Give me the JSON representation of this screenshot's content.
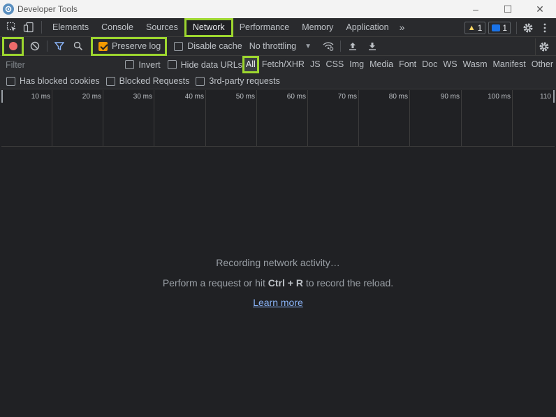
{
  "window": {
    "title": "Developer Tools",
    "minimize_glyph": "–",
    "maximize_glyph": "☐",
    "close_glyph": "✕"
  },
  "tabs": [
    {
      "label": "Elements"
    },
    {
      "label": "Console"
    },
    {
      "label": "Sources"
    },
    {
      "label": "Network",
      "active": true
    },
    {
      "label": "Performance"
    },
    {
      "label": "Memory"
    },
    {
      "label": "Application"
    }
  ],
  "tab_overflow": "»",
  "badges": {
    "warnings": "1",
    "messages": "1"
  },
  "toolbar": {
    "preserve_log_label": "Preserve log",
    "preserve_log_checked": true,
    "disable_cache_label": "Disable cache",
    "disable_cache_checked": false,
    "throttling_value": "No throttling"
  },
  "filter": {
    "placeholder": "Filter",
    "invert_label": "Invert",
    "hide_data_urls_label": "Hide data URLs",
    "types": [
      "All",
      "Fetch/XHR",
      "JS",
      "CSS",
      "Img",
      "Media",
      "Font",
      "Doc",
      "WS",
      "Wasm",
      "Manifest",
      "Other"
    ],
    "active_type": "All"
  },
  "filter2": {
    "has_blocked_cookies_label": "Has blocked cookies",
    "blocked_requests_label": "Blocked Requests",
    "third_party_label": "3rd-party requests"
  },
  "timeline": {
    "ticks": [
      "10 ms",
      "20 ms",
      "30 ms",
      "40 ms",
      "50 ms",
      "60 ms",
      "70 ms",
      "80 ms",
      "90 ms",
      "100 ms",
      "110"
    ]
  },
  "empty_state": {
    "line1": "Recording network activity…",
    "line2_before": "Perform a request or hit ",
    "line2_shortcut": "Ctrl + R",
    "line2_after": " to record the reload.",
    "link": "Learn more"
  },
  "colors": {
    "highlight": "#9dd62f",
    "record": "#ee6b6b",
    "checkbox_checked": "#f29900",
    "link": "#8ab4f8"
  }
}
